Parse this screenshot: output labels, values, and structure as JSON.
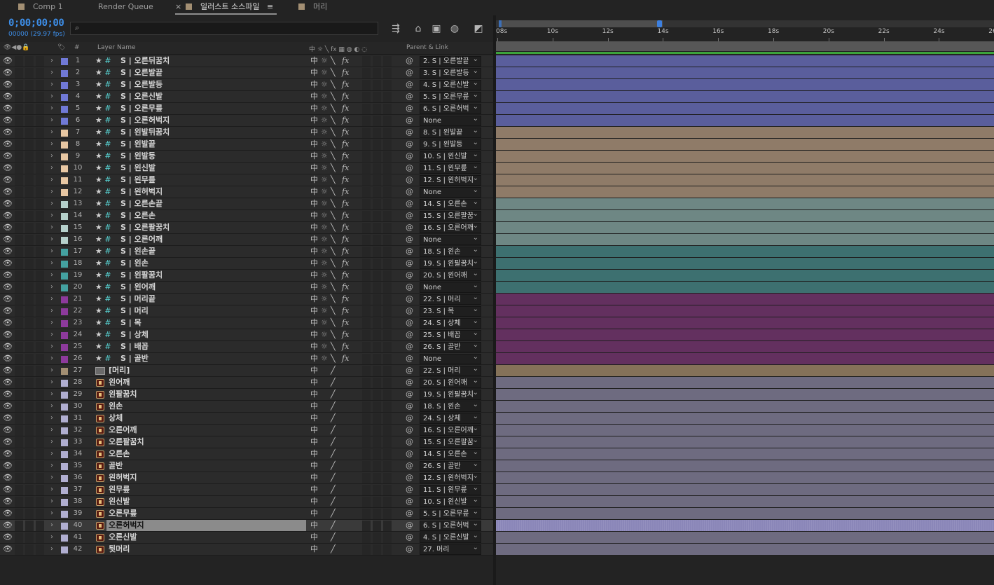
{
  "tabs": [
    {
      "label": "Comp 1",
      "color": "#a38f73",
      "active": false
    },
    {
      "label": "Render Queue",
      "active": false
    },
    {
      "label": "일러스트 소스파일",
      "color": "#a38f73",
      "active": true,
      "close": "×",
      "menu": "≡"
    },
    {
      "label": "머리",
      "color": "#a38f73",
      "active": false
    }
  ],
  "timecode": "0;00;00;00",
  "fps": "00000 (29.97 fps)",
  "search": {
    "icon": "search-icon",
    "glyph": "⌕",
    "placeholder": ""
  },
  "toolbar": [
    {
      "name": "comp-mini-flowchart-icon",
      "glyph": "⇶"
    },
    {
      "name": "draft-3d-icon",
      "glyph": "⌂"
    },
    {
      "name": "frame-blending-icon",
      "glyph": "▣"
    },
    {
      "name": "motion-blur-icon",
      "glyph": "◍"
    },
    {
      "name": "graph-editor-icon",
      "glyph": "◩"
    }
  ],
  "columns": {
    "av": "👁◀●🔒",
    "label": "🏷",
    "num": "#",
    "layer_name": "Layer Name",
    "switches": "中 ☼ ╲ fx ▦ ◍ ◐ ◌",
    "parent": "Parent & Link"
  },
  "label_colors": {
    "blue": "#7079d6",
    "sand": "#e8c7a3",
    "sea": "#b6d0cb",
    "teal": "#44a1a0",
    "purple": "#8d3a9c",
    "tan": "#a38f73",
    "lavender": "#b0aed0"
  },
  "bar_colors": {
    "blue": "#5a5e9c",
    "sand": "#8f7b68",
    "sea": "#6e8784",
    "teal": "#3d7070",
    "purple": "#63305f",
    "tan": "#857259",
    "lavender": "#6e6b80"
  },
  "ruler": {
    "labels": [
      "08s",
      "10s",
      "12s",
      "14s",
      "16s",
      "18s",
      "20s",
      "22s",
      "24s",
      "26"
    ]
  },
  "layers": [
    {
      "num": "1",
      "name": "S | 오른뒤꿈치",
      "color": "blue",
      "type": "shape",
      "parent": "2. S | 오른발끝"
    },
    {
      "num": "2",
      "name": "S | 오른발끝",
      "color": "blue",
      "type": "shape",
      "parent": "3. S | 오른발등"
    },
    {
      "num": "3",
      "name": "S | 오른발등",
      "color": "blue",
      "type": "shape",
      "parent": "4. S | 오른신발"
    },
    {
      "num": "4",
      "name": "S | 오른신발",
      "color": "blue",
      "type": "shape",
      "parent": "5. S | 오른무릎"
    },
    {
      "num": "5",
      "name": "S | 오른무릎",
      "color": "blue",
      "type": "shape",
      "parent": "6. S | 오른허벅"
    },
    {
      "num": "6",
      "name": "S | 오른허벅지",
      "color": "blue",
      "type": "shape",
      "parent": "None"
    },
    {
      "num": "7",
      "name": "S | 왼발뒤꿈치",
      "color": "sand",
      "type": "shape",
      "parent": "8. S | 왼발끝"
    },
    {
      "num": "8",
      "name": "S | 왼발끝",
      "color": "sand",
      "type": "shape",
      "parent": "9. S | 왼발등"
    },
    {
      "num": "9",
      "name": "S | 왼발등",
      "color": "sand",
      "type": "shape",
      "parent": "10. S | 왼신발"
    },
    {
      "num": "10",
      "name": "S | 왼신발",
      "color": "sand",
      "type": "shape",
      "parent": "11. S | 왼무릎"
    },
    {
      "num": "11",
      "name": "S | 왼무릎",
      "color": "sand",
      "type": "shape",
      "parent": "12. S | 왼허벅지"
    },
    {
      "num": "12",
      "name": "S | 왼허벅지",
      "color": "sand",
      "type": "shape",
      "parent": "None"
    },
    {
      "num": "13",
      "name": "S | 오른손끝",
      "color": "sea",
      "type": "shape",
      "parent": "14. S | 오른손"
    },
    {
      "num": "14",
      "name": "S | 오른손",
      "color": "sea",
      "type": "shape",
      "parent": "15. S | 오른팔꿈"
    },
    {
      "num": "15",
      "name": "S | 오른팔꿈치",
      "color": "sea",
      "type": "shape",
      "parent": "16. S | 오른어깨"
    },
    {
      "num": "16",
      "name": "S | 오른어깨",
      "color": "sea",
      "type": "shape",
      "parent": "None"
    },
    {
      "num": "17",
      "name": "S | 왼손끝",
      "color": "teal",
      "type": "shape",
      "parent": "18. S | 왼손"
    },
    {
      "num": "18",
      "name": "S | 왼손",
      "color": "teal",
      "type": "shape",
      "parent": "19. S | 왼팔꿈치"
    },
    {
      "num": "19",
      "name": "S | 왼팔꿈치",
      "color": "teal",
      "type": "shape",
      "parent": "20. S | 왼어깨"
    },
    {
      "num": "20",
      "name": "S | 왼어깨",
      "color": "teal",
      "type": "shape",
      "parent": "None"
    },
    {
      "num": "21",
      "name": "S | 머리끝",
      "color": "purple",
      "type": "shape",
      "parent": "22. S | 머리"
    },
    {
      "num": "22",
      "name": "S | 머리",
      "color": "purple",
      "type": "shape",
      "parent": "23. S | 목"
    },
    {
      "num": "23",
      "name": "S | 목",
      "color": "purple",
      "type": "shape",
      "parent": "24. S | 상체"
    },
    {
      "num": "24",
      "name": "S | 상체",
      "color": "purple",
      "type": "shape",
      "parent": "25. S | 배꼽"
    },
    {
      "num": "25",
      "name": "S | 배꼽",
      "color": "purple",
      "type": "shape",
      "parent": "26. S | 골반"
    },
    {
      "num": "26",
      "name": "S | 골반",
      "color": "purple",
      "type": "shape",
      "parent": "None"
    },
    {
      "num": "27",
      "name": "[머리]",
      "color": "tan",
      "type": "comp",
      "parent": "22. S | 머리"
    },
    {
      "num": "28",
      "name": "왼어깨",
      "color": "lavender",
      "type": "ai",
      "parent": "20. S | 왼어깨"
    },
    {
      "num": "29",
      "name": "왼팔꿈치",
      "color": "lavender",
      "type": "ai",
      "parent": "19. S | 왼팔꿈치"
    },
    {
      "num": "30",
      "name": "왼손",
      "color": "lavender",
      "type": "ai",
      "parent": "18. S | 왼손"
    },
    {
      "num": "31",
      "name": "상체",
      "color": "lavender",
      "type": "ai",
      "parent": "24. S | 상체"
    },
    {
      "num": "32",
      "name": "오른어깨",
      "color": "lavender",
      "type": "ai",
      "parent": "16. S | 오른어깨"
    },
    {
      "num": "33",
      "name": "오른팔꿈치",
      "color": "lavender",
      "type": "ai",
      "parent": "15. S | 오른팔꿈"
    },
    {
      "num": "34",
      "name": "오른손",
      "color": "lavender",
      "type": "ai",
      "parent": "14. S | 오른손"
    },
    {
      "num": "35",
      "name": "골반",
      "color": "lavender",
      "type": "ai",
      "parent": "26. S | 골반"
    },
    {
      "num": "36",
      "name": "왼허벅지",
      "color": "lavender",
      "type": "ai",
      "parent": "12. S | 왼허벅지"
    },
    {
      "num": "37",
      "name": "왼무릎",
      "color": "lavender",
      "type": "ai",
      "parent": "11. S | 왼무릎"
    },
    {
      "num": "38",
      "name": "왼신발",
      "color": "lavender",
      "type": "ai",
      "parent": "10. S | 왼신발"
    },
    {
      "num": "39",
      "name": "오른무릎",
      "color": "lavender",
      "type": "ai",
      "parent": "5. S | 오른무릎"
    },
    {
      "num": "40",
      "name": "오른허벅지",
      "color": "lavender",
      "type": "ai",
      "parent": "6. S | 오른허벅",
      "selected": true
    },
    {
      "num": "41",
      "name": "오른신발",
      "color": "lavender",
      "type": "ai",
      "parent": "4. S | 오른신발"
    },
    {
      "num": "42",
      "name": "뒷머리",
      "color": "lavender",
      "type": "ai",
      "parent": "27. 머리"
    }
  ],
  "glyphs": {
    "eye": "👁",
    "chevron": "›",
    "star": "★",
    "hash": "#",
    "shy": "中",
    "collapse": "☼",
    "quality_shape": "╲",
    "quality_ai": "╱",
    "fx": "fx",
    "pickwhip": "@"
  }
}
